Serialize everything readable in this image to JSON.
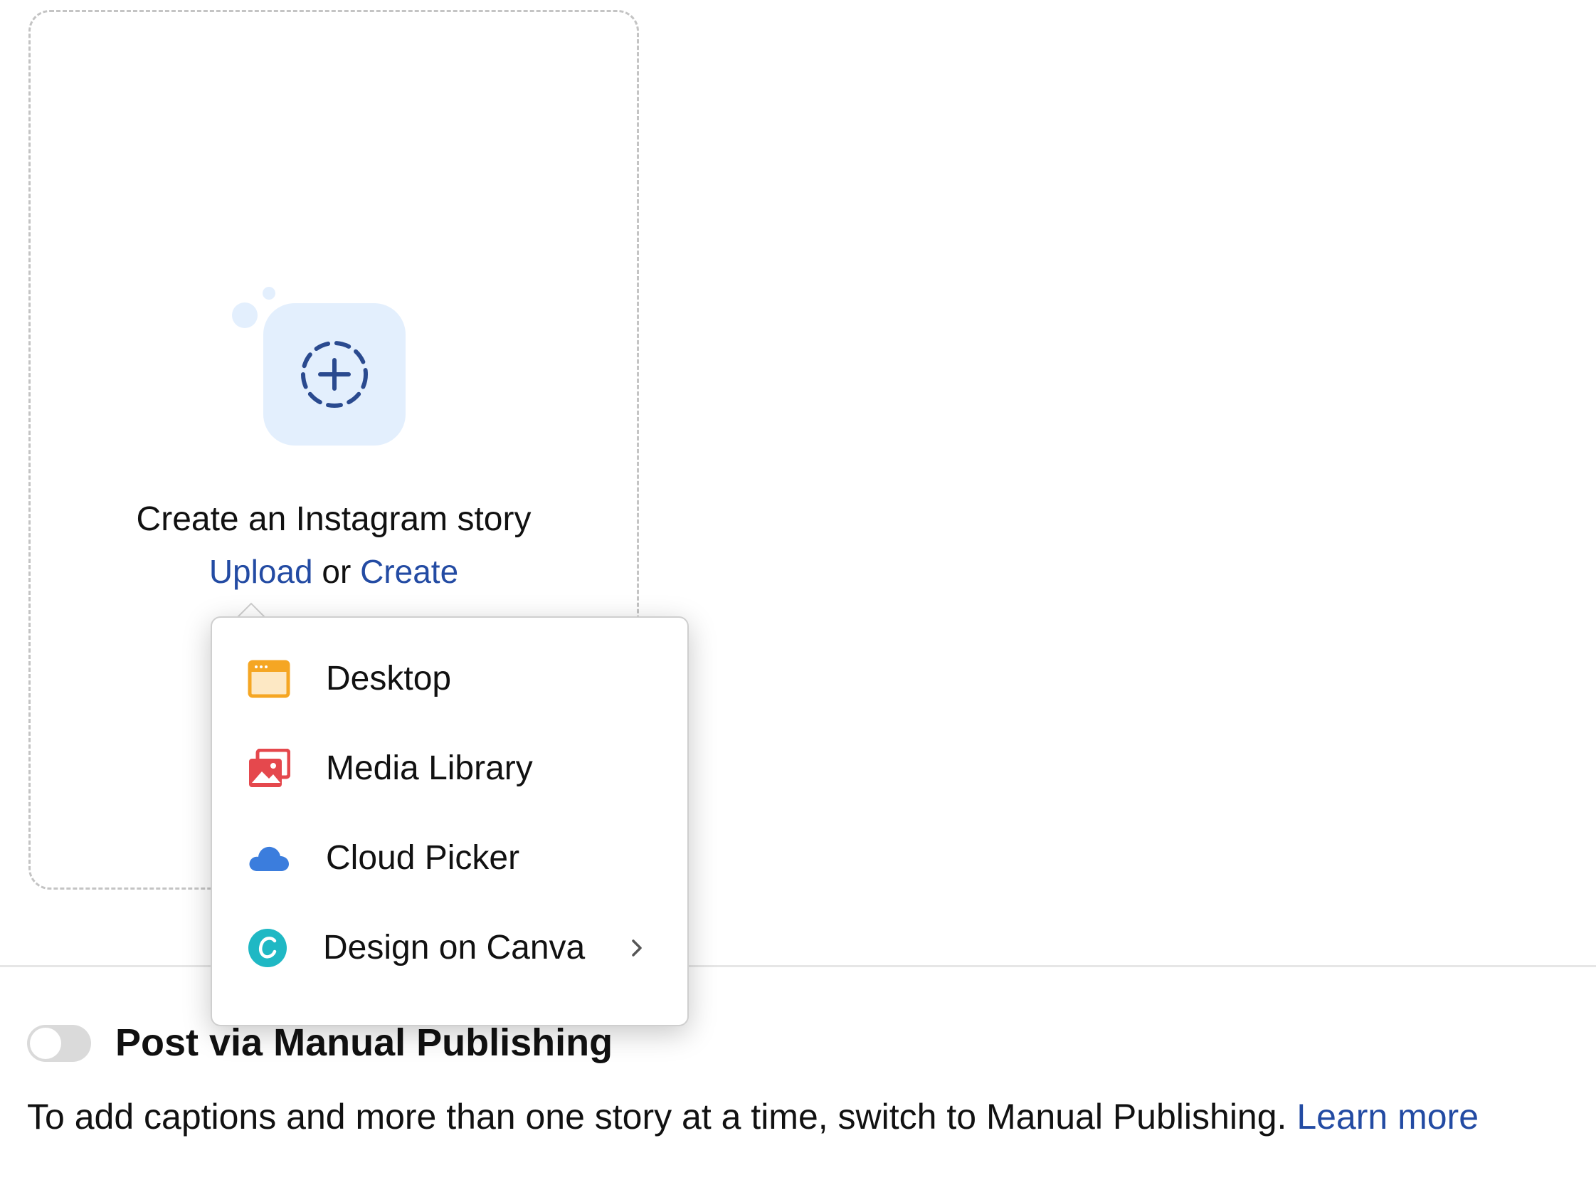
{
  "upload": {
    "title": "Create an Instagram story",
    "upload_link": "Upload",
    "or_text": " or ",
    "create_link": "Create",
    "icon": "add-circle-icon"
  },
  "upload_menu": {
    "items": [
      {
        "label": "Desktop",
        "icon": "desktop-window-icon",
        "color": "#f5a623"
      },
      {
        "label": "Media Library",
        "icon": "media-library-icon",
        "color": "#e5484d"
      },
      {
        "label": "Cloud Picker",
        "icon": "cloud-icon",
        "color": "#3b7ddd"
      },
      {
        "label": "Design on Canva",
        "icon": "canva-icon",
        "color": "#1fb8c4",
        "has_submenu": true
      }
    ]
  },
  "manual_publishing": {
    "toggle_on": false,
    "label": "Post via Manual Publishing",
    "help_text": "To add captions and more than one story at a time, switch to Manual Publishing. ",
    "learn_more": "Learn more"
  },
  "colors": {
    "link": "#234ba3",
    "tile_bg": "#e3effd",
    "icon_blue": "#2a4a8f"
  }
}
